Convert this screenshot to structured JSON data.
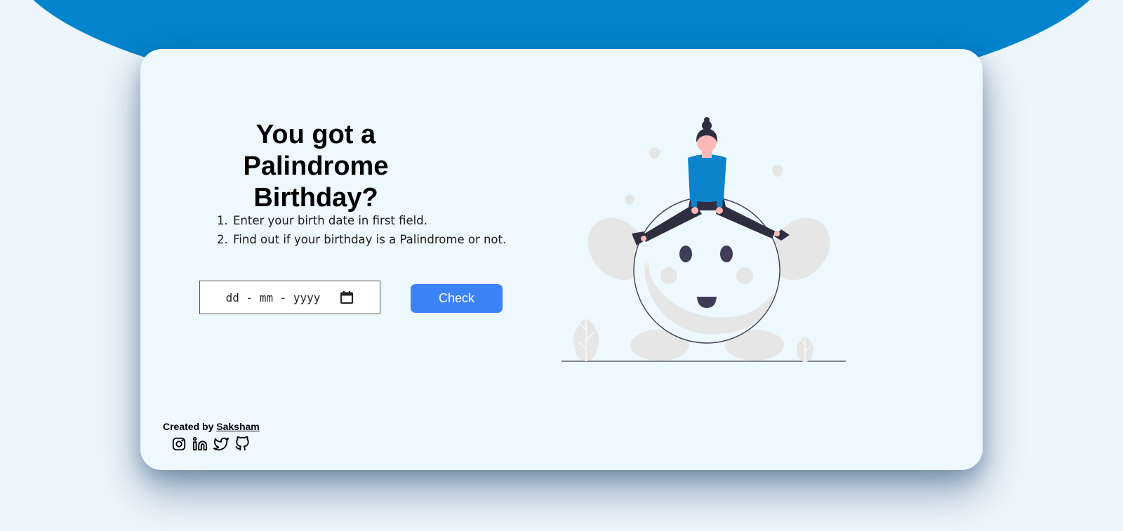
{
  "hero": {
    "title": "You got a Palindrome Birthday?"
  },
  "instructions": [
    "Enter your birth date in first field.",
    "Find out if your birthday is a Palindrome or not."
  ],
  "date_input": {
    "placeholder": "dd - mm - yyyy",
    "icon": "calendar-icon"
  },
  "check_button": {
    "label": "Check"
  },
  "footer": {
    "credit_prefix": "Created by",
    "author": "Saksham",
    "socials": [
      "instagram-icon",
      "linkedin-icon",
      "twitter-icon",
      "github-icon"
    ]
  },
  "colors": {
    "accent_blob": "#0384cc",
    "button": "#3b82f6",
    "card_bg": "#eef8ff",
    "figure_shirt": "#0b84cc"
  }
}
